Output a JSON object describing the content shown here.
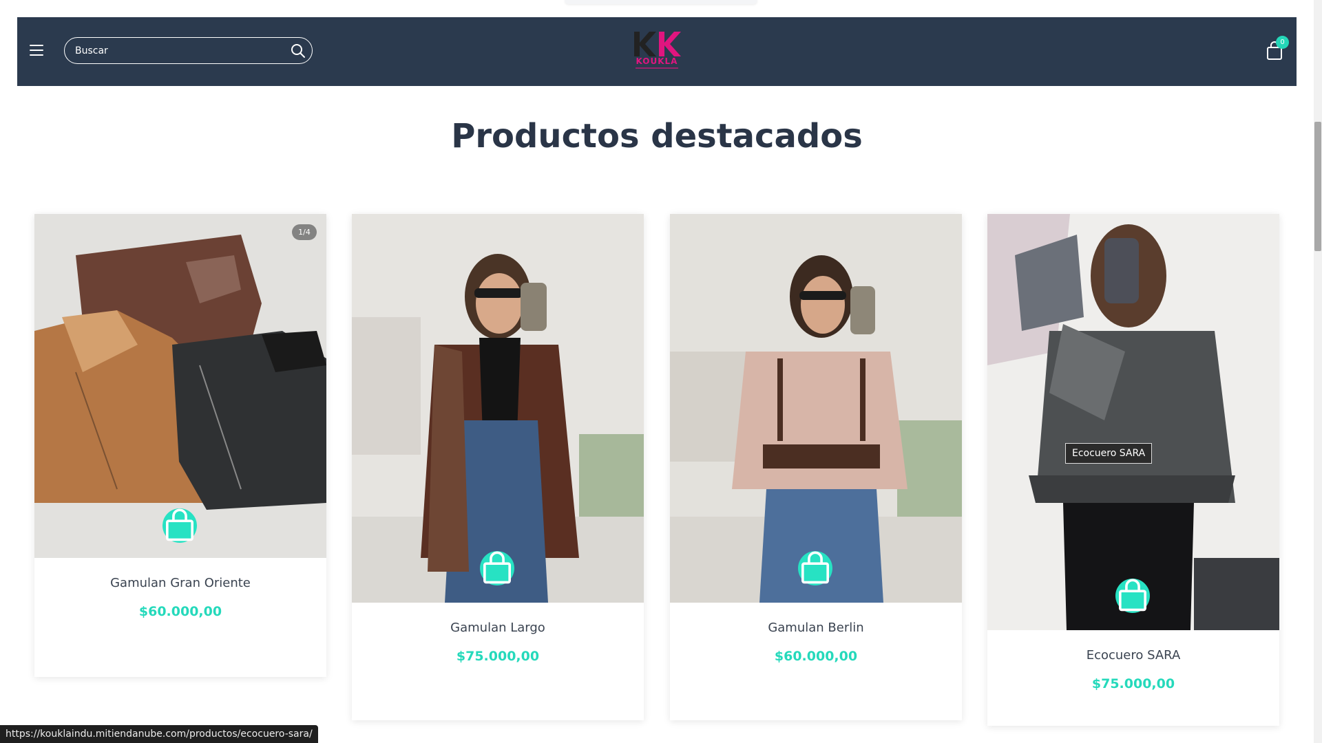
{
  "header": {
    "menu_icon": "hamburger-icon",
    "search": {
      "placeholder": "Buscar",
      "icon": "search-icon"
    },
    "logo": {
      "word": "KOUKLA",
      "colors": {
        "k1": "#222222",
        "k2": "#e0157f"
      }
    },
    "cart": {
      "icon": "shopping-bag-icon",
      "count": "0"
    },
    "background": "#2b3a4e"
  },
  "section": {
    "title": "Productos destacados"
  },
  "products": [
    {
      "name": "Gamulan Gran Oriente",
      "price": "$60.000,00",
      "counter": "1/4"
    },
    {
      "name": "Gamulan Largo",
      "price": "$75.000,00"
    },
    {
      "name": "Gamulan Berlin",
      "price": "$60.000,00"
    },
    {
      "name": "Ecocuero SARA",
      "price": "$75.000,00"
    }
  ],
  "tooltip": "Ecocuero SARA",
  "status_url": "https://kouklaindu.mitiendanube.com/productos/ecocuero-sara/",
  "colors": {
    "accent": "#27e2c3",
    "price": "#25d9bb",
    "title": "#2a3547"
  }
}
